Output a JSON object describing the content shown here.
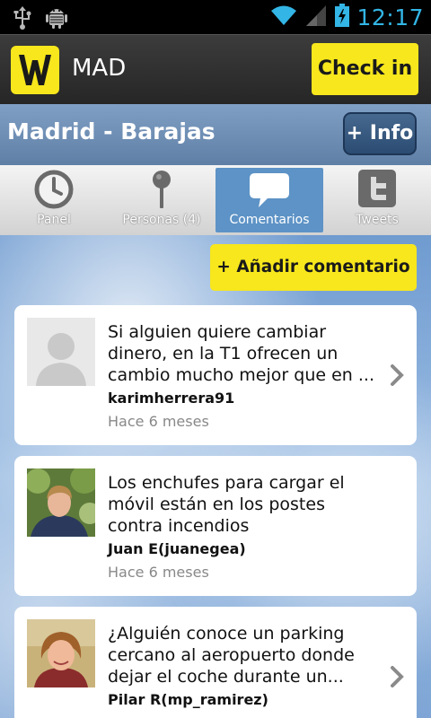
{
  "status_bar": {
    "time": "12:17",
    "icons": [
      "usb-icon",
      "android-debug-icon",
      "wifi-icon",
      "signal-icon",
      "battery-charging-icon"
    ],
    "accent_color": "#33b5e5"
  },
  "header": {
    "title": "MAD",
    "logo": "w-logo",
    "checkin_label": "Check in",
    "brand_color": "#f7e71c"
  },
  "location": {
    "name": "Madrid - Barajas",
    "info_label": "+ Info"
  },
  "tabs": [
    {
      "label": "Panel",
      "icon": "clock-icon",
      "active": false
    },
    {
      "label": "Personas (4)",
      "icon": "pin-icon",
      "active": false
    },
    {
      "label": "Comentarios",
      "icon": "speech-bubble-icon",
      "active": true
    },
    {
      "label": "Tweets",
      "icon": "twitter-icon",
      "active": false
    }
  ],
  "actions": {
    "add_comment_label": "+ Añadir comentario"
  },
  "comments": [
    {
      "text": "Si alguien quiere cambiar dinero, en la T1 ofrecen un cambio mucho mejor que en ...",
      "author": "karimherrera91",
      "time": "Hace 6 meses",
      "avatar": "default-avatar",
      "has_chevron": true
    },
    {
      "text": "Los enchufes para cargar el móvil están en los postes contra incendios",
      "author": "Juan E(juanegea)",
      "time": "Hace 6 meses",
      "avatar": "photo-avatar-man",
      "has_chevron": false
    },
    {
      "text": "¿Alguién conoce un parking cercano al aeropuerto donde dejar el coche durante un...",
      "author": "Pilar R(mp_ramirez)",
      "time": "",
      "avatar": "photo-avatar-woman",
      "has_chevron": true
    }
  ]
}
